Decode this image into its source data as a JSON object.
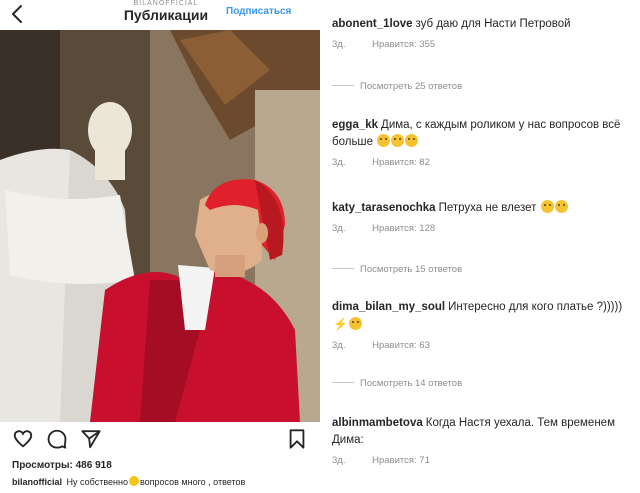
{
  "header": {
    "account": "BILANOFFICIAL",
    "title": "Публикации",
    "follow_label": "Подписаться"
  },
  "post": {
    "views_label": "Просмотры:",
    "views_count": "486 918",
    "caption_user": "bilanofficial",
    "caption_before_emoji": "Ну собственно",
    "caption_after_emoji": "вопросов много , ответов"
  },
  "icons": [
    "back-arrow-icon",
    "heart-icon",
    "comment-icon",
    "share-icon",
    "bookmark-icon",
    "laughing-emoji-icon",
    "lightning-emoji-icon"
  ],
  "colors": {
    "link": "#3897f0",
    "muted": "#8e8e8e",
    "text": "#262626",
    "jacket": "#c8102e",
    "hair": "#e0202a"
  },
  "comments": [
    {
      "user": "abonent_1love",
      "text": "зуб даю для Насти Петровой",
      "time": "3д.",
      "likes": "Нравится: 355",
      "replies": "Посмотреть 25 ответов"
    },
    {
      "user": "egga_kk",
      "text": "Дима, с каждым роликом у нас вопросов всё больше",
      "time": "3д.",
      "likes": "Нравится: 82"
    },
    {
      "user": "katy_tarasenochka",
      "text": "Петруха не влезет",
      "time": "3д.",
      "likes": "Нравится: 128",
      "replies": "Посмотреть 15 ответов"
    },
    {
      "user": "dima_bilan_my_soul",
      "text": "Интересно для кого платье ?)))))",
      "time": "3д.",
      "likes": "Нравится: 63",
      "replies": "Посмотреть 14 ответов"
    },
    {
      "user": "albinmambetova",
      "text": "Когда Настя уехала. Тем временем Дима:",
      "time": "3д.",
      "likes": "Нравится: 71"
    }
  ]
}
